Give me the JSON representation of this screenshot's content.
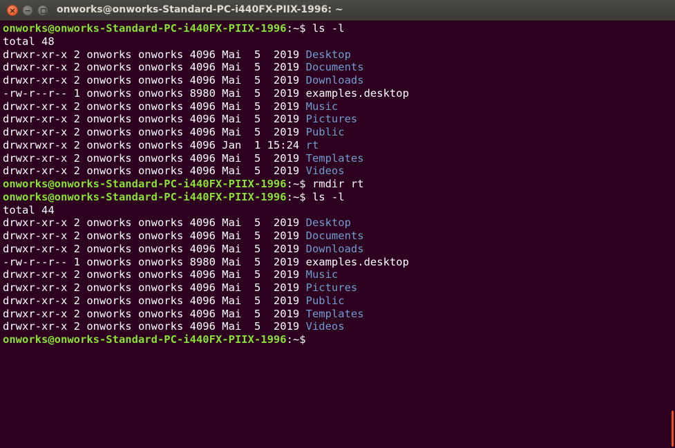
{
  "window": {
    "title": "onworks@onworks-Standard-PC-i440FX-PIIX-1996: ~",
    "close_glyph": "×",
    "minimize_glyph": "−"
  },
  "colors": {
    "background": "#2c001e",
    "prompt": "#8ae234",
    "directory": "#729fcf",
    "text": "#ffffff",
    "titlebar": "#3c3b37",
    "close_button": "#e2511f"
  },
  "terminal": {
    "lines": [
      {
        "type": "prompt",
        "user_host": "onworks@onworks-Standard-PC-i440FX-PIIX-1996",
        "sep": ":~$ ",
        "command": "ls -l"
      },
      {
        "type": "text",
        "text": "total 48"
      },
      {
        "type": "entry",
        "prefix": "drwxr-xr-x 2 onworks onworks 4096 Mai  5  2019 ",
        "name": "Desktop",
        "is_dir": true
      },
      {
        "type": "entry",
        "prefix": "drwxr-xr-x 2 onworks onworks 4096 Mai  5  2019 ",
        "name": "Documents",
        "is_dir": true
      },
      {
        "type": "entry",
        "prefix": "drwxr-xr-x 2 onworks onworks 4096 Mai  5  2019 ",
        "name": "Downloads",
        "is_dir": true
      },
      {
        "type": "entry",
        "prefix": "-rw-r--r-- 1 onworks onworks 8980 Mai  5  2019 ",
        "name": "examples.desktop",
        "is_dir": false
      },
      {
        "type": "entry",
        "prefix": "drwxr-xr-x 2 onworks onworks 4096 Mai  5  2019 ",
        "name": "Music",
        "is_dir": true
      },
      {
        "type": "entry",
        "prefix": "drwxr-xr-x 2 onworks onworks 4096 Mai  5  2019 ",
        "name": "Pictures",
        "is_dir": true
      },
      {
        "type": "entry",
        "prefix": "drwxr-xr-x 2 onworks onworks 4096 Mai  5  2019 ",
        "name": "Public",
        "is_dir": true
      },
      {
        "type": "entry",
        "prefix": "drwxrwxr-x 2 onworks onworks 4096 Jan  1 15:24 ",
        "name": "rt",
        "is_dir": true
      },
      {
        "type": "entry",
        "prefix": "drwxr-xr-x 2 onworks onworks 4096 Mai  5  2019 ",
        "name": "Templates",
        "is_dir": true
      },
      {
        "type": "entry",
        "prefix": "drwxr-xr-x 2 onworks onworks 4096 Mai  5  2019 ",
        "name": "Videos",
        "is_dir": true
      },
      {
        "type": "prompt",
        "user_host": "onworks@onworks-Standard-PC-i440FX-PIIX-1996",
        "sep": ":~$ ",
        "command": "rmdir rt"
      },
      {
        "type": "prompt",
        "user_host": "onworks@onworks-Standard-PC-i440FX-PIIX-1996",
        "sep": ":~$ ",
        "command": "ls -l"
      },
      {
        "type": "text",
        "text": "total 44"
      },
      {
        "type": "entry",
        "prefix": "drwxr-xr-x 2 onworks onworks 4096 Mai  5  2019 ",
        "name": "Desktop",
        "is_dir": true
      },
      {
        "type": "entry",
        "prefix": "drwxr-xr-x 2 onworks onworks 4096 Mai  5  2019 ",
        "name": "Documents",
        "is_dir": true
      },
      {
        "type": "entry",
        "prefix": "drwxr-xr-x 2 onworks onworks 4096 Mai  5  2019 ",
        "name": "Downloads",
        "is_dir": true
      },
      {
        "type": "entry",
        "prefix": "-rw-r--r-- 1 onworks onworks 8980 Mai  5  2019 ",
        "name": "examples.desktop",
        "is_dir": false
      },
      {
        "type": "entry",
        "prefix": "drwxr-xr-x 2 onworks onworks 4096 Mai  5  2019 ",
        "name": "Music",
        "is_dir": true
      },
      {
        "type": "entry",
        "prefix": "drwxr-xr-x 2 onworks onworks 4096 Mai  5  2019 ",
        "name": "Pictures",
        "is_dir": true
      },
      {
        "type": "entry",
        "prefix": "drwxr-xr-x 2 onworks onworks 4096 Mai  5  2019 ",
        "name": "Public",
        "is_dir": true
      },
      {
        "type": "entry",
        "prefix": "drwxr-xr-x 2 onworks onworks 4096 Mai  5  2019 ",
        "name": "Templates",
        "is_dir": true
      },
      {
        "type": "entry",
        "prefix": "drwxr-xr-x 2 onworks onworks 4096 Mai  5  2019 ",
        "name": "Videos",
        "is_dir": true
      },
      {
        "type": "prompt",
        "user_host": "onworks@onworks-Standard-PC-i440FX-PIIX-1996",
        "sep": ":~$",
        "command": "",
        "cursor": true
      }
    ]
  }
}
